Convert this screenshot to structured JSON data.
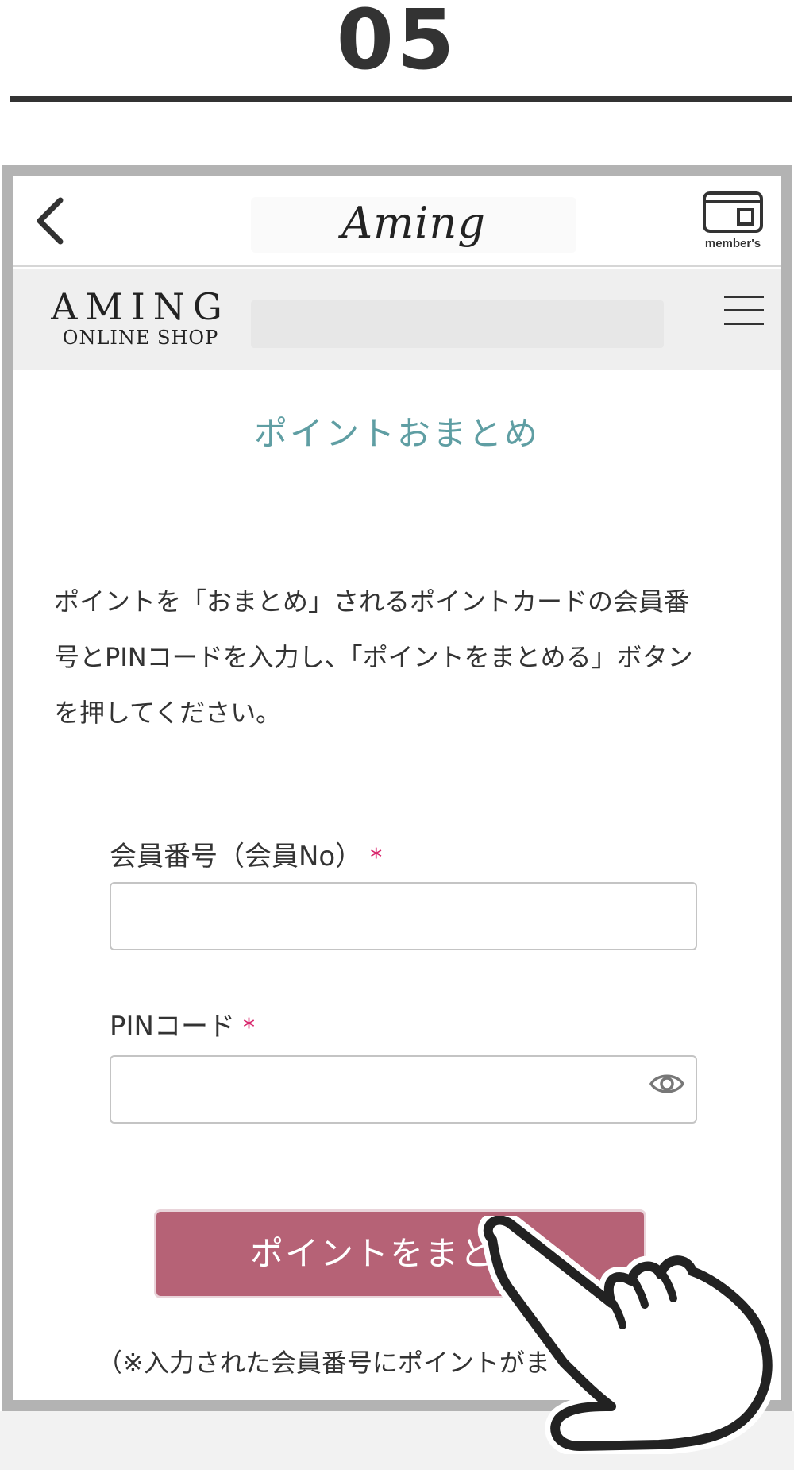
{
  "step": {
    "number": "05"
  },
  "appbar": {
    "brand": "Aming",
    "member_label": "member's"
  },
  "shop": {
    "logo_main": "AMING",
    "logo_sub": "ONLINE SHOP"
  },
  "page": {
    "title": "ポイントおまとめ",
    "intro_line1": "ポイントを「おまとめ」されるポイントカードの会員番",
    "intro_line2": "号とPINコードを入力し、「ポイントをまとめる」ボタン",
    "intro_line3": "を押してください。"
  },
  "form": {
    "member_no_label": "会員番号（会員No）",
    "member_no_value": "",
    "pin_label": "PINコード",
    "pin_value": "",
    "required_mark": "*",
    "submit_label": "ポイントをまと",
    "note": "（※入力された会員番号にポイントがま"
  },
  "colors": {
    "title": "#5f9ea3",
    "button": "#b66276",
    "required": "#d8246b",
    "frame": "#b3b3b3"
  },
  "icons": [
    "chevron-left-icon",
    "member-card-icon",
    "hamburger-menu-icon",
    "eye-icon",
    "pointing-hand-icon"
  ]
}
